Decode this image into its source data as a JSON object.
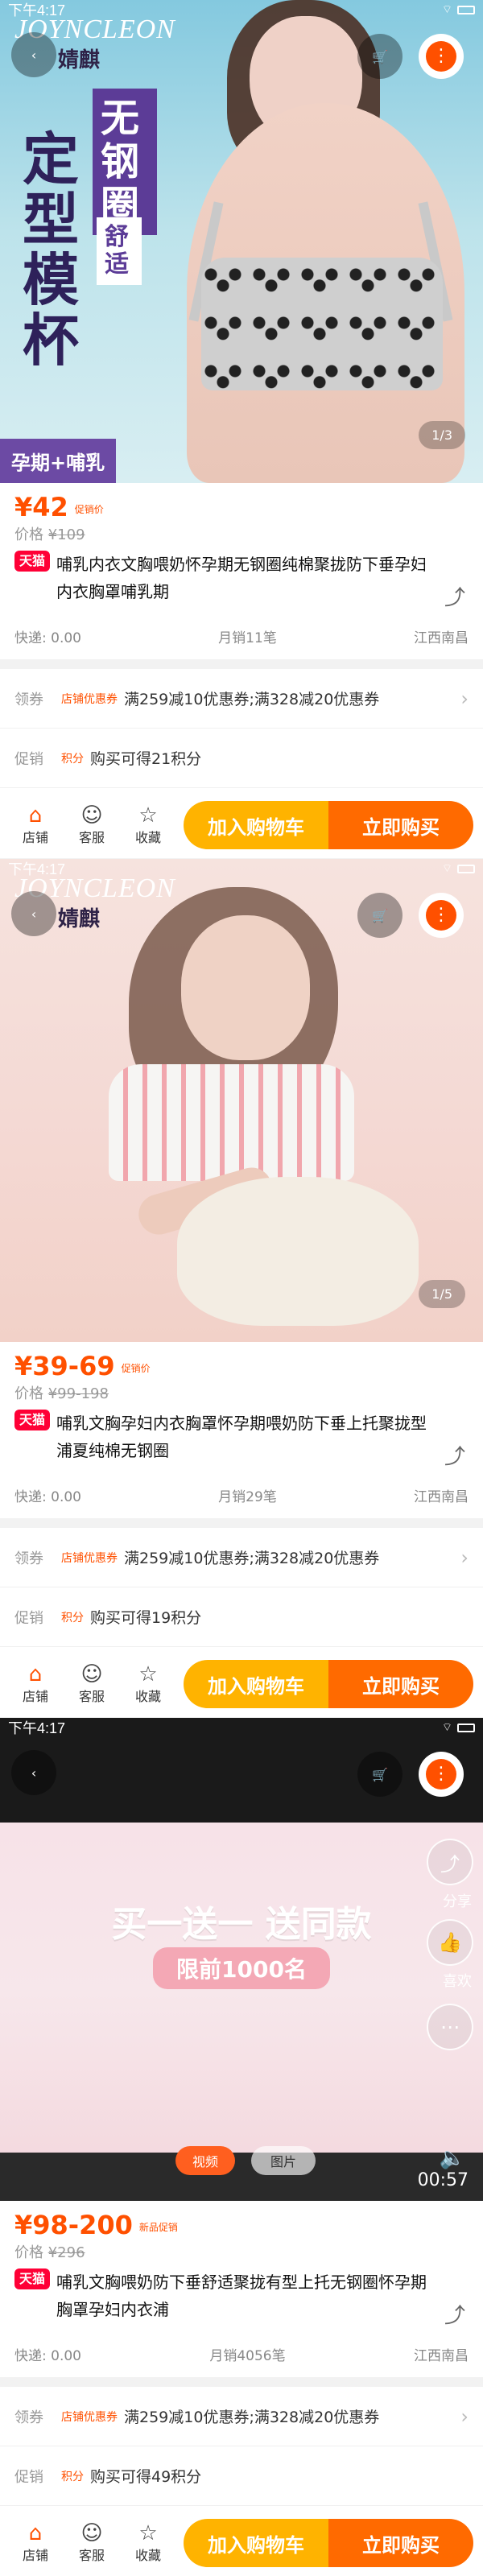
{
  "status_time": "下午4:17",
  "buttons": {
    "add_cart": "加入购物车",
    "buy_now": "立即购买"
  },
  "footer": {
    "shop": "店铺",
    "service": "客服",
    "favorite": "收藏"
  },
  "hero_brand": {
    "en": "JOYNCLEON",
    "cn": "婧麒"
  },
  "panels": [
    {
      "counter": "1/3",
      "hero_text": {
        "line1": "定型模杯",
        "line2": "无钢圈",
        "line3": "舒适",
        "tag": "孕期+哺乳"
      },
      "price": "¥42",
      "price_tag": "促销价",
      "origin_label": "价格",
      "origin_price": "¥109",
      "tmall": "天猫",
      "title": "哺乳内衣文胸喂奶怀孕期无钢圈纯棉聚拢防下垂孕妇内衣胸罩哺乳期",
      "meta": {
        "shipping": "快递: 0.00",
        "sales": "月销11笔",
        "location": "江西南昌"
      },
      "coupon": {
        "label": "领券",
        "tag": "店铺优惠券",
        "text": "满259减10优惠券;满328减20优惠券"
      },
      "promo": {
        "label": "促销",
        "tag": "积分",
        "text": "购买可得21积分"
      }
    },
    {
      "counter": "1/5",
      "price": "¥39-69",
      "price_tag": "促销价",
      "origin_label": "价格",
      "origin_price": "¥99-198",
      "tmall": "天猫",
      "title": "哺乳文胸孕妇内衣胸罩怀孕期喂奶防下垂上托聚拢型浦夏纯棉无钢圈",
      "meta": {
        "shipping": "快递: 0.00",
        "sales": "月销29笔",
        "location": "江西南昌"
      },
      "coupon": {
        "label": "领券",
        "tag": "店铺优惠券",
        "text": "满259减10优惠券;满328减20优惠券"
      },
      "promo": {
        "label": "促销",
        "tag": "积分",
        "text": "购买可得19积分"
      }
    },
    {
      "video_labels": {
        "video": "视频",
        "image": "图片"
      },
      "promo_text": {
        "main": "买一送一  送同款",
        "sub": "限前1000名"
      },
      "side": {
        "left": "分享",
        "right": "喜欢"
      },
      "timer": "00:57",
      "price": "¥98-200",
      "price_tag": "新品促销",
      "origin_label": "价格",
      "origin_price": "¥296",
      "tmall": "天猫",
      "title": "哺乳文胸喂奶防下垂舒适聚拢有型上托无钢圈怀孕期胸罩孕妇内衣浦",
      "meta": {
        "shipping": "快递: 0.00",
        "sales": "月销4056笔",
        "location": "江西南昌"
      },
      "coupon": {
        "label": "领券",
        "tag": "店铺优惠券",
        "text": "满259减10优惠券;满328减20优惠券"
      },
      "promo": {
        "label": "促销",
        "tag": "积分",
        "text": "购买可得49积分"
      }
    }
  ],
  "colors": {
    "accent": "#ff5000",
    "tmall": "#ff0036",
    "cta_left": "#ffb300",
    "cta_right": "#ff6a00"
  }
}
